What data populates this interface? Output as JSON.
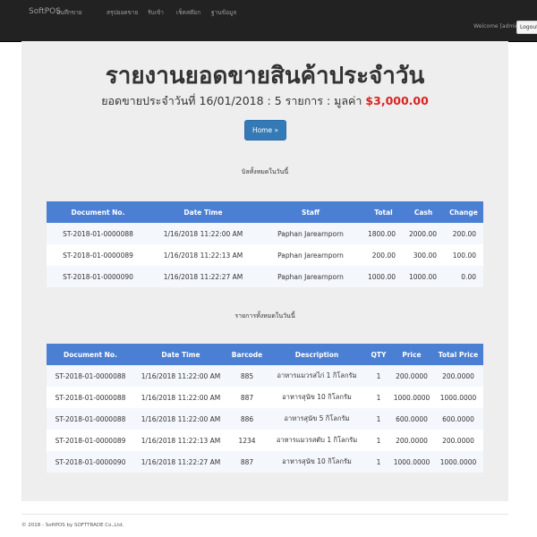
{
  "navbar": {
    "brand": "SoftPOS",
    "items": [
      "บันทึกขาย",
      "สรุปยอดขาย",
      "รับเข้า",
      "เช็คสต๊อก",
      "ฐานข้อมูล"
    ],
    "welcome": "Welcome [admin]",
    "logout": "Logout"
  },
  "report": {
    "title": "รายงานยอดขายสินค้าประจำวัน",
    "subtitle_prefix": "ยอดขายประจำวันที่ 16/01/2018 : 5 รายการ : มูลค่า",
    "amount": "$3,000.00",
    "home_button": "Home »"
  },
  "bills": {
    "label": "บิลทั้งหมดในวันนี้",
    "headers": [
      "Document No.",
      "Date Time",
      "Staff",
      "Total",
      "Cash",
      "Change"
    ],
    "rows": [
      [
        "ST-2018-01-0000088",
        "1/16/2018 11:22:00 AM",
        "Paphan Jarearnporn",
        "1800.00",
        "2000.00",
        "200.00"
      ],
      [
        "ST-2018-01-0000089",
        "1/16/2018 11:22:13 AM",
        "Paphan Jarearnporn",
        "200.00",
        "300.00",
        "100.00"
      ],
      [
        "ST-2018-01-0000090",
        "1/16/2018 11:22:27 AM",
        "Paphan Jarearnporn",
        "1000.00",
        "1000.00",
        "0.00"
      ]
    ]
  },
  "items": {
    "label": "รายการทั้งหมดในวันนี้",
    "headers": [
      "Document No.",
      "Date Time",
      "Barcode",
      "Description",
      "QTY",
      "Price",
      "Total Price"
    ],
    "rows": [
      [
        "ST-2018-01-0000088",
        "1/16/2018 11:22:00 AM",
        "885",
        "อาหารแมวรสไก่ 1 กิโลกรัม",
        "1",
        "200.0000",
        "200.0000"
      ],
      [
        "ST-2018-01-0000088",
        "1/16/2018 11:22:00 AM",
        "887",
        "อาหารสุนัข 10 กิโลกรัม",
        "1",
        "1000.0000",
        "1000.0000"
      ],
      [
        "ST-2018-01-0000088",
        "1/16/2018 11:22:00 AM",
        "886",
        "อาหารสุนัข 5 กิโลกรัม",
        "1",
        "600.0000",
        "600.0000"
      ],
      [
        "ST-2018-01-0000089",
        "1/16/2018 11:22:13 AM",
        "1234",
        "อาหารแมวรสตับ 1 กิโลกรัม",
        "1",
        "200.0000",
        "200.0000"
      ],
      [
        "ST-2018-01-0000090",
        "1/16/2018 11:22:27 AM",
        "887",
        "อาหารสุนัข 10 กิโลกรัม",
        "1",
        "1000.0000",
        "1000.0000"
      ]
    ]
  },
  "footer": "© 2018 - SoftPOS by SOFTTRADE Co.,Ltd.",
  "colors": {
    "navbar": "#222222",
    "table_header": "#4a7fd4",
    "amount": "#d9241f",
    "button": "#337ab7"
  }
}
